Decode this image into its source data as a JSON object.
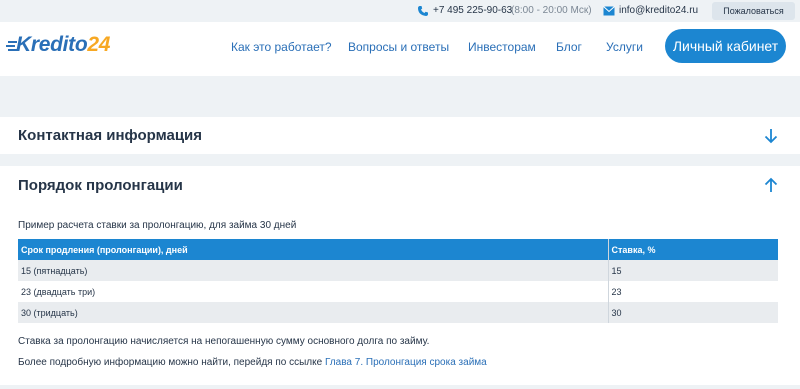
{
  "topbar": {
    "phone": "+7 495 225-90-63",
    "hours": "(8:00 - 20:00 Мск)",
    "email": "info@kredito24.ru",
    "complain_label": "Пожаловаться"
  },
  "logo": {
    "text": "Kredito",
    "number": "24"
  },
  "nav": {
    "items": [
      {
        "label": "Как это работает?"
      },
      {
        "label": "Вопросы и ответы"
      },
      {
        "label": "Инвесторам"
      },
      {
        "label": "Блог"
      },
      {
        "label": "Услуги"
      }
    ],
    "cabinet_label": "Личный кабинет"
  },
  "sections": {
    "contacts": {
      "title": "Контактная информация",
      "icon": "arrow-down-icon"
    },
    "prolongation": {
      "title": "Порядок пролонгации",
      "icon": "arrow-up-icon",
      "intro": "Пример расчета ставки за пролонгацию, для займа 30 дней",
      "table": {
        "headers": [
          "Срок продления (пролонгации), дней",
          "Ставка, %"
        ],
        "rows": [
          [
            "15 (пятнадцать)",
            "15"
          ],
          [
            "23 (двадцать три)",
            "23"
          ],
          [
            "30 (тридцать)",
            "30"
          ]
        ]
      },
      "note": "Ставка за пролонгацию начисляется на непогашенную сумму основного долга по займу.",
      "more_text": "Более подробную информацию можно найти, перейдя по ссылке",
      "more_link": "Глава 7. Пролонгация срока займа"
    }
  },
  "colors": {
    "accent": "#1c86d1",
    "link": "#2a6fb7",
    "logo_orange": "#f7a823",
    "page_bg": "#eef2f5"
  }
}
